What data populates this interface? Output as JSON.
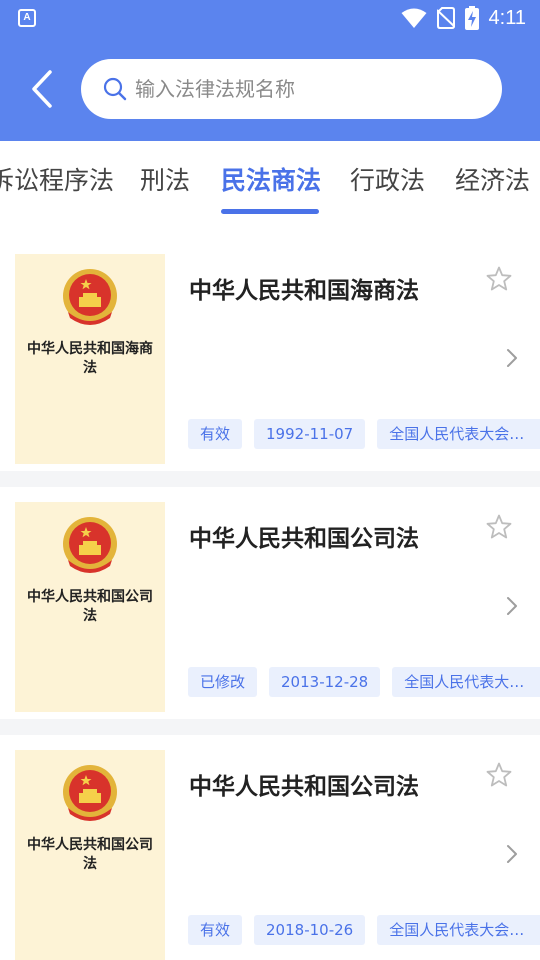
{
  "status_bar": {
    "app_icon": "A",
    "time": "4:11"
  },
  "search": {
    "placeholder": "输入法律法规名称",
    "value": ""
  },
  "tabs": [
    {
      "label": "诉讼程序法",
      "active": false
    },
    {
      "label": "刑法",
      "active": false
    },
    {
      "label": "民法商法",
      "active": true
    },
    {
      "label": "行政法",
      "active": false
    },
    {
      "label": "经济法",
      "active": false
    }
  ],
  "laws": [
    {
      "cover_title": "中华人民共和国海商法",
      "title": "中华人民共和国海商法",
      "status": "有效",
      "date": "1992-11-07",
      "issuer": "全国人民代表大会常..."
    },
    {
      "cover_title": "中华人民共和国公司法",
      "title": "中华人民共和国公司法",
      "status": "已修改",
      "date": "2013-12-28",
      "issuer": "全国人民代表大会..."
    },
    {
      "cover_title": "中华人民共和国公司法",
      "title": "中华人民共和国公司法",
      "status": "有效",
      "date": "2018-10-26",
      "issuer": "全国人民代表大会常..."
    }
  ],
  "colors": {
    "header": "#5b84ee",
    "accent": "#4a72e8",
    "tag_bg": "#eaf0fd",
    "cover_bg": "#fdf3d6"
  }
}
